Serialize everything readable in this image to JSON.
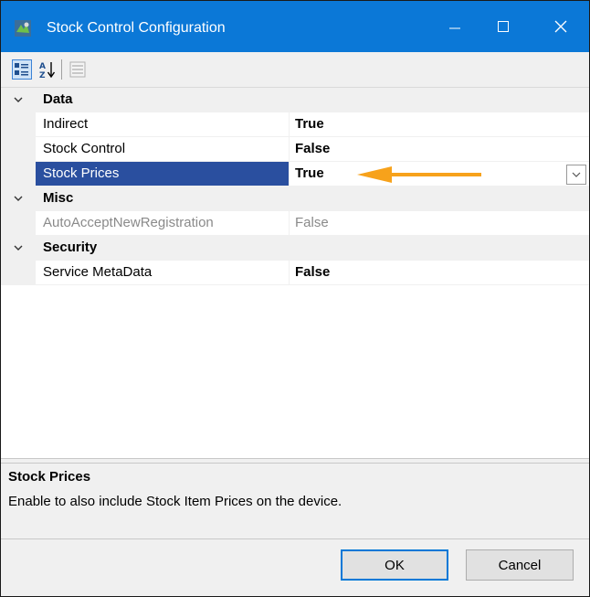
{
  "window": {
    "title": "Stock Control Configuration",
    "accent_color": "#0b78d7"
  },
  "toolbar": {
    "categorized_icon": "categorized-icon",
    "alphabetical_icon": "sort-alpha-icon",
    "property_pages_icon": "property-pages-icon"
  },
  "grid": {
    "categories": [
      {
        "name": "Data",
        "properties": [
          {
            "name": "Indirect",
            "value": "True"
          },
          {
            "name": "Stock Control",
            "value": "False"
          },
          {
            "name": "Stock Prices",
            "value": "True",
            "selected": true
          }
        ]
      },
      {
        "name": "Misc",
        "properties": [
          {
            "name": "AutoAcceptNewRegistration",
            "value": "False",
            "disabled": true
          }
        ]
      },
      {
        "name": "Security",
        "properties": [
          {
            "name": "Service MetaData",
            "value": "False"
          }
        ]
      }
    ],
    "annotation_arrow_color": "#f7a21b"
  },
  "help": {
    "title": "Stock Prices",
    "description": "Enable to also include Stock Item Prices on the device."
  },
  "buttons": {
    "ok": "OK",
    "cancel": "Cancel"
  }
}
